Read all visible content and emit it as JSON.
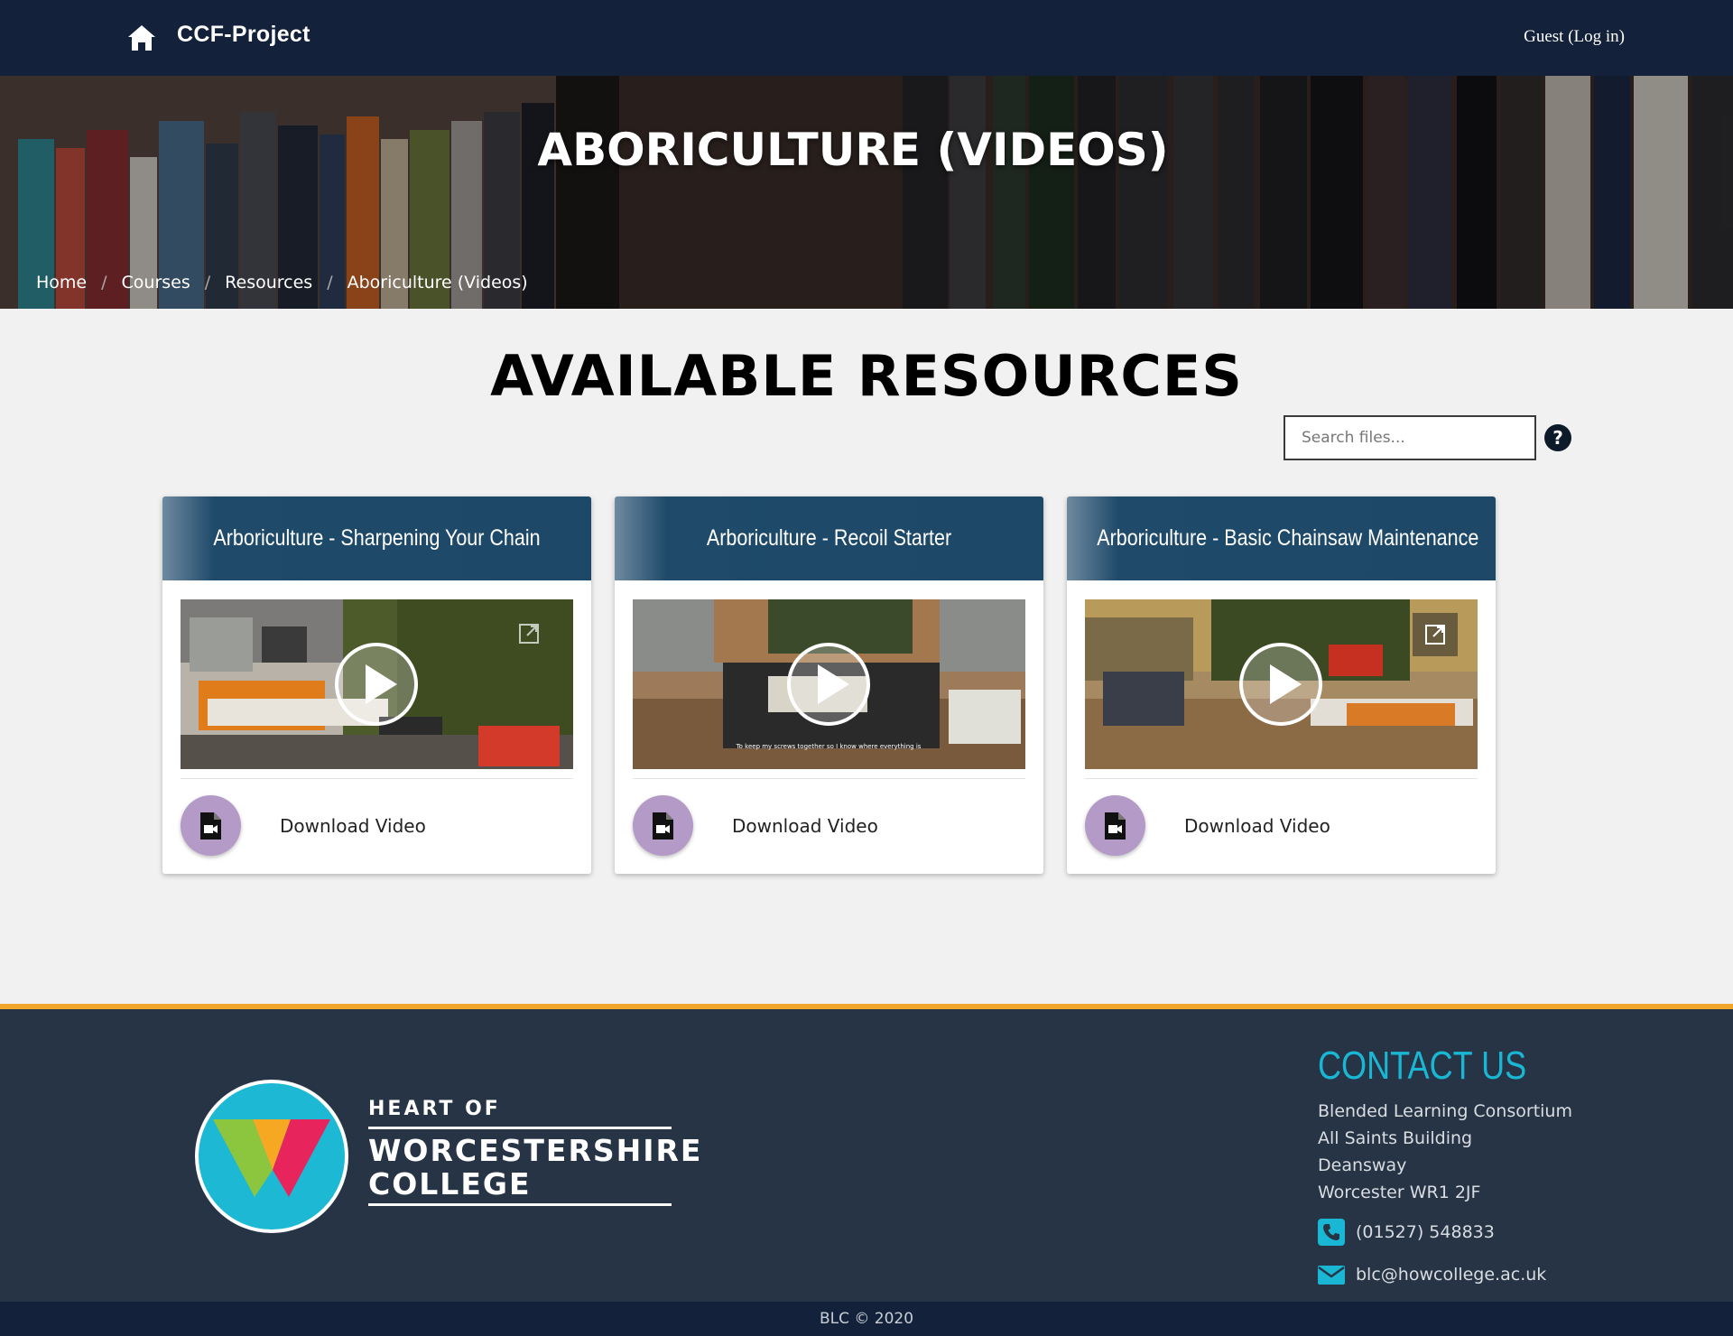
{
  "nav": {
    "brand": "CCF-Project",
    "login": "Guest (Log in)"
  },
  "hero": {
    "title": "ABORICULTURE (VIDEOS)",
    "breadcrumb": [
      "Home",
      "Courses",
      "Resources",
      "Aboriculture (Videos)"
    ]
  },
  "main": {
    "title": "AVAILABLE RESOURCES",
    "search_placeholder": "Search files..."
  },
  "cards": [
    {
      "title": "Arboriculture - Sharpening Your Chain",
      "download_label": "Download Video"
    },
    {
      "title": "Arboriculture - Recoil Starter",
      "download_label": "Download Video",
      "caption": "To keep my screws together so I know where everything is"
    },
    {
      "title": "Arboriculture - Basic Chainsaw Maintenance",
      "download_label": "Download Video"
    }
  ],
  "footer": {
    "logo": {
      "line1": "HEART OF",
      "line2": "WORCESTERSHIRE",
      "line3": "COLLEGE"
    },
    "contact_title": "CONTACT US",
    "address": [
      "Blended Learning Consortium",
      "All Saints Building",
      "Deansway",
      "Worcester WR1 2JF"
    ],
    "phone": "(01527) 548833",
    "email": "blc@howcollege.ac.uk",
    "copyright": "BLC © 2020"
  },
  "colors": {
    "navbar": "#13213a",
    "card_header": "#1d4868",
    "download_circle": "#b49ac6",
    "footer_bg": "#263445",
    "footer_accent": "#f0a52b",
    "contact_accent": "#19b7d4"
  },
  "icons": [
    "home-icon",
    "help-icon",
    "play-icon",
    "external-link-icon",
    "video-file-icon",
    "phone-icon",
    "email-icon"
  ]
}
